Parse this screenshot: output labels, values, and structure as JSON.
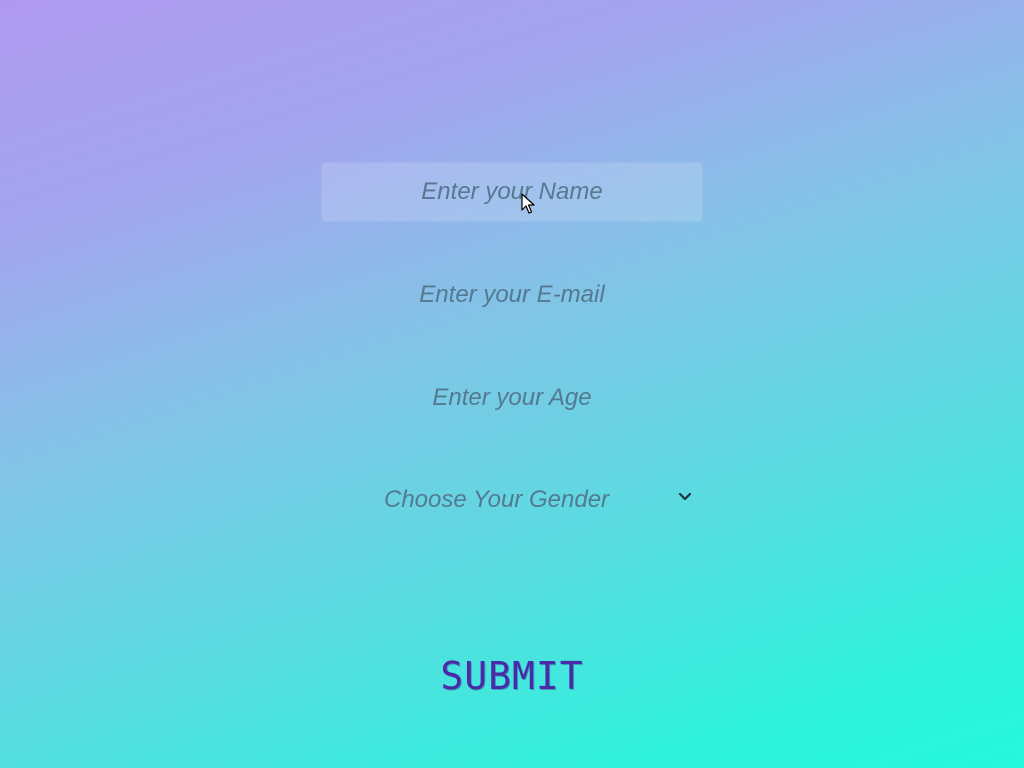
{
  "form": {
    "name_placeholder": "Enter your Name",
    "email_placeholder": "Enter your E-mail",
    "age_placeholder": "Enter your Age",
    "gender_select": {
      "selected": "Choose Your Gender",
      "icon": "chevron-down-icon"
    },
    "submit_label": "SUBMIT"
  },
  "pointer": {
    "icon": "mouse-pointer-icon"
  },
  "colors": {
    "background_top": "#b09af0",
    "background_bottom": "#25f8dc",
    "placeholder_text": "#537a90",
    "submit_text": "#4a2aa8"
  }
}
